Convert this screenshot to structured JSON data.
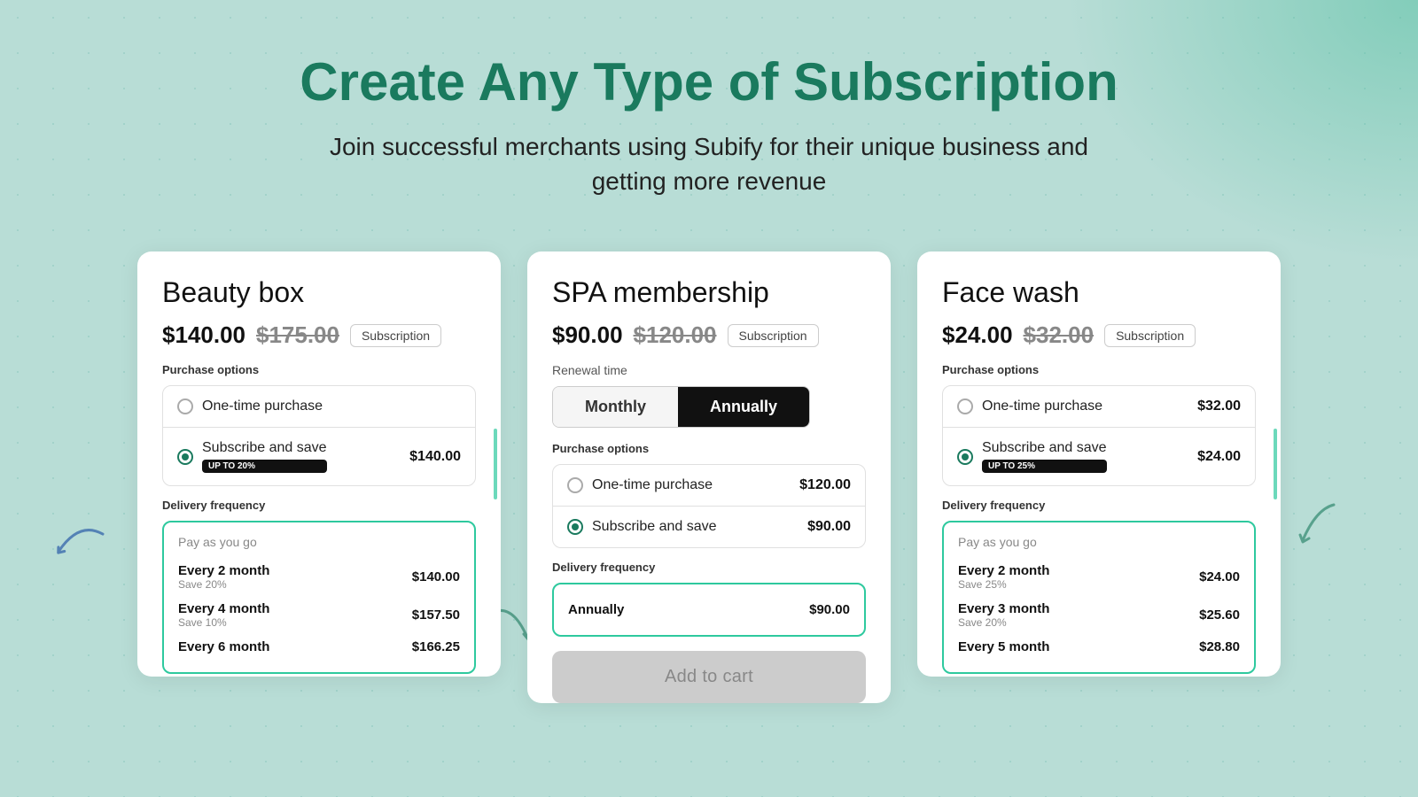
{
  "page": {
    "bg_color": "#b8ddd6"
  },
  "header": {
    "title": "Create Any Type of Subscription",
    "subtitle_line1": "Join successful merchants using Subify for their unique business and",
    "subtitle_line2": "getting more revenue"
  },
  "cards": [
    {
      "id": "beauty-box",
      "title": "Beauty box",
      "price_current": "$140.00",
      "price_original": "$175.00",
      "badge": "Subscription",
      "section_label": "Purchase options",
      "options": [
        {
          "type": "radio-empty",
          "label": "One-time purchase",
          "price": ""
        },
        {
          "type": "radio-filled",
          "label": "Subscribe and save",
          "badge": "UP To 20%",
          "price": "$140.00"
        }
      ],
      "delivery_label": "Delivery frequency",
      "delivery_sublabel": "Pay as you go",
      "frequencies": [
        {
          "label": "Every 2 month",
          "save": "Save 20%",
          "price": "$140.00"
        },
        {
          "label": "Every 4 month",
          "save": "Save 10%",
          "price": "$157.50"
        },
        {
          "label": "Every 6 month",
          "save": "",
          "price": "$166.25"
        }
      ]
    },
    {
      "id": "spa-membership",
      "title": "SPA membership",
      "price_current": "$90.00",
      "price_original": "$120.00",
      "badge": "Subscription",
      "renewal_label": "Renewal time",
      "toggle": {
        "options": [
          "Monthly",
          "Annually"
        ],
        "active": "Annually"
      },
      "section_label": "Purchase options",
      "options": [
        {
          "type": "radio-empty",
          "label": "One-time purchase",
          "price": "$120.00"
        },
        {
          "type": "radio-filled",
          "label": "Subscribe and save",
          "price": "$90.00"
        }
      ],
      "delivery_label": "Delivery frequency",
      "frequencies": [
        {
          "label": "Annually",
          "save": "",
          "price": "$90.00"
        }
      ],
      "add_to_cart": "Add to cart"
    },
    {
      "id": "face-wash",
      "title": "Face wash",
      "price_current": "$24.00",
      "price_original": "$32.00",
      "badge": "Subscription",
      "section_label": "Purchase options",
      "options": [
        {
          "type": "radio-empty",
          "label": "One-time purchase",
          "price": "$32.00"
        },
        {
          "type": "radio-filled",
          "label": "Subscribe and save",
          "badge": "UP To 25%",
          "price": "$24.00"
        }
      ],
      "delivery_label": "Delivery frequency",
      "delivery_sublabel": "Pay as you go",
      "frequencies": [
        {
          "label": "Every 2 month",
          "save": "Save 25%",
          "price": "$24.00"
        },
        {
          "label": "Every 3 month",
          "save": "Save 20%",
          "price": "$25.60"
        },
        {
          "label": "Every 5 month",
          "save": "",
          "price": "$28.80"
        }
      ]
    }
  ]
}
